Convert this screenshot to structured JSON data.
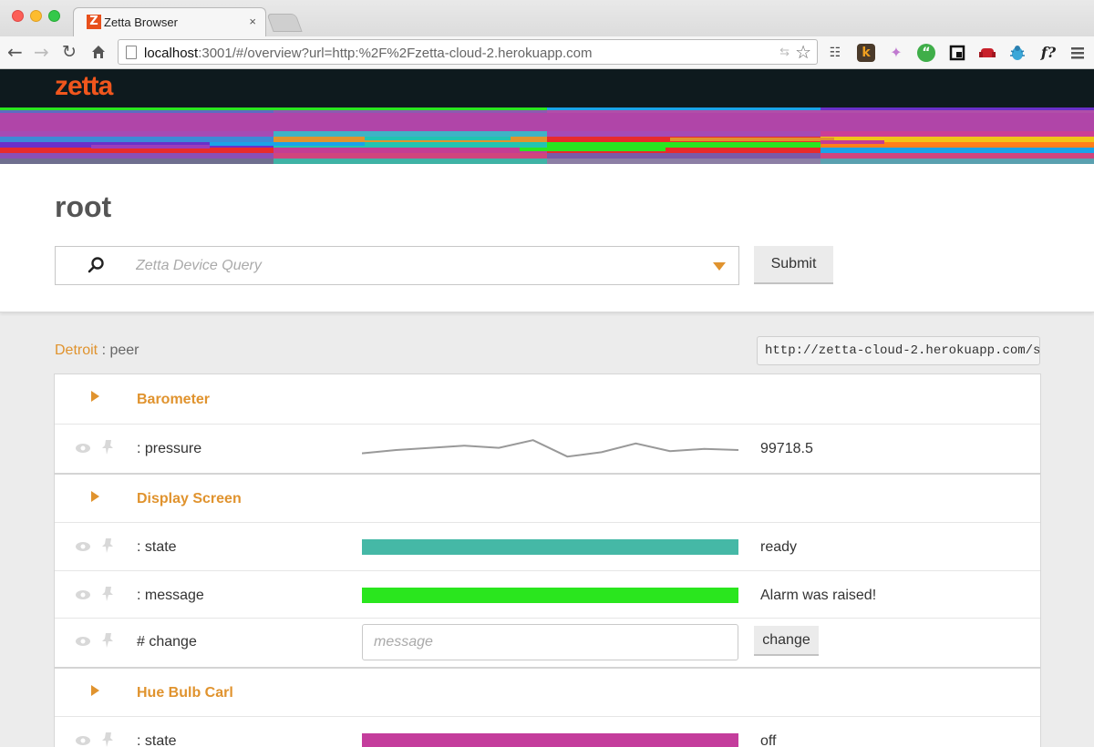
{
  "browser": {
    "tab_title": "Zetta Browser",
    "tab_favicon": "Z",
    "tab_close": "×",
    "url_host": "localhost",
    "url_rest": ":3001/#/overview?url=http:%2F%2Fzetta-cloud-2.herokuapp.com",
    "extensions": [
      "evernote-icon",
      "k-extension-icon",
      "pinwheel-icon",
      "hangouts-icon",
      "pocket-icon",
      "sofa-icon",
      "bug-icon",
      "formula-icon",
      "menu-icon"
    ]
  },
  "app": {
    "logo": "zetta",
    "page_title": "root",
    "query_placeholder": "Zetta Device Query",
    "submit_label": "Submit",
    "stripe_colors": [
      "#22c4b0",
      "#e0932e",
      "#9b3dbb",
      "#2ae620",
      "#c43d93",
      "#1aa3e8",
      "#e82b2b",
      "#6a30c9",
      "#f0c419",
      "#ff7f1a"
    ]
  },
  "peer": {
    "name": "Detroit",
    "suffix": " : peer",
    "url": "http://zetta-cloud-2.herokuapp.com/s"
  },
  "devices": [
    {
      "name": "Barometer",
      "streams": [
        {
          "label": ": pressure",
          "value": "99718.5",
          "sparkline": [
            0.35,
            0.5,
            0.6,
            0.7,
            0.6,
            0.95,
            0.2,
            0.4,
            0.8,
            0.45,
            0.55,
            0.5
          ]
        }
      ]
    },
    {
      "name": "Display Screen",
      "streams": [
        {
          "label": ": state",
          "value": "ready",
          "color": "#45b8a6"
        },
        {
          "label": ": message",
          "value": "Alarm was raised!",
          "color": "#2ae61e"
        }
      ],
      "transition": {
        "label": "# change",
        "placeholder": "message",
        "button": "change"
      }
    },
    {
      "name": "Hue Bulb Carl",
      "streams": [
        {
          "label": ": state",
          "value": "off",
          "color": "#c43d9c"
        }
      ]
    }
  ]
}
